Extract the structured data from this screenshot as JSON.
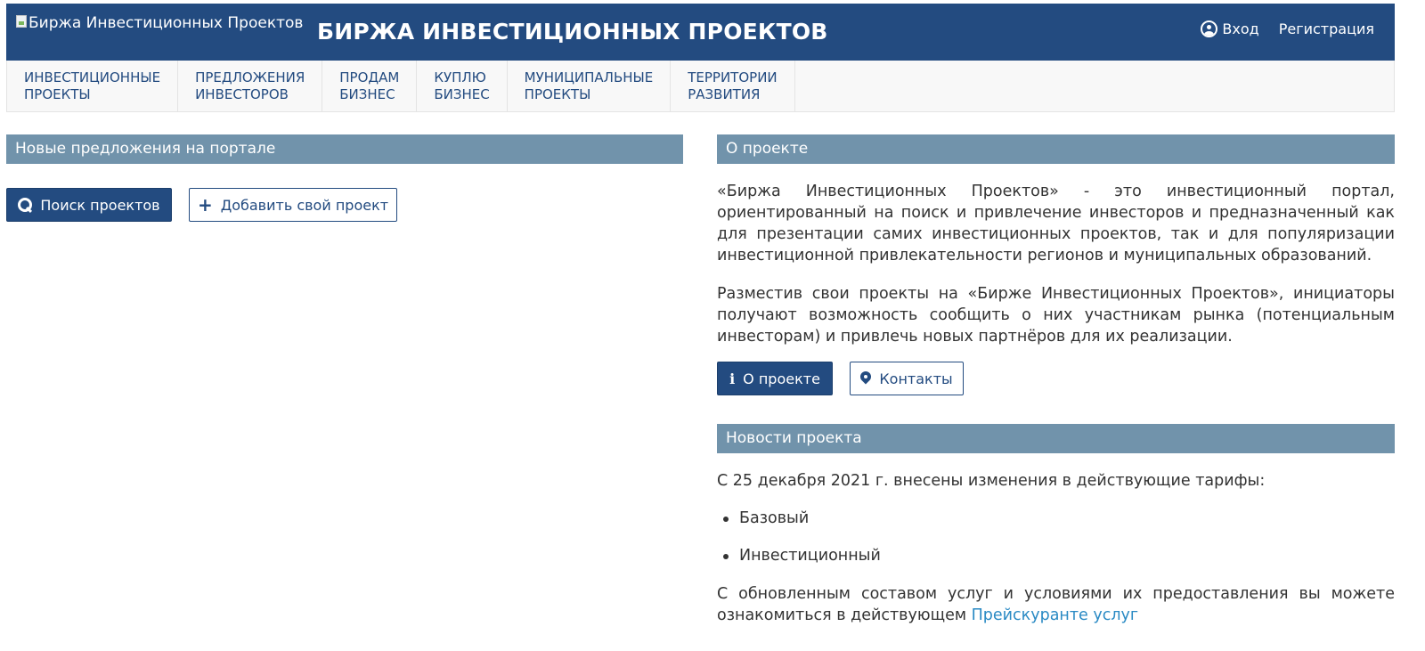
{
  "header": {
    "logo_alt": "Биржа Инвестиционных Проектов",
    "site_title": "БИРЖА ИНВЕСТИЦИОННЫХ ПРОЕКТОВ",
    "login_label": "Вход",
    "register_label": "Регистрация"
  },
  "nav": {
    "items": [
      {
        "line1": "ИНВЕСТИЦИОННЫЕ",
        "line2": "ПРОЕКТЫ"
      },
      {
        "line1": "ПРЕДЛОЖЕНИЯ",
        "line2": "ИНВЕСТОРОВ"
      },
      {
        "line1": "ПРОДАМ",
        "line2": "БИЗНЕС"
      },
      {
        "line1": "КУПЛЮ",
        "line2": "БИЗНЕС"
      },
      {
        "line1": "МУНИЦИПАЛЬНЫЕ",
        "line2": "ПРОЕКТЫ"
      },
      {
        "line1": "ТЕРРИТОРИИ",
        "line2": "РАЗВИТИЯ"
      }
    ]
  },
  "left": {
    "section_title": "Новые предложения на портале",
    "search_button": "Поиск проектов",
    "add_button": "Добавить свой проект"
  },
  "about": {
    "section_title": "О проекте",
    "paragraph1": "«Биржа Инвестиционных Проектов» - это инвестиционный портал, ориентированный на поиск и привлечение инвесторов и предназначенный как для презентации самих инвестиционных проектов, так и для популяризации инвестиционной привлекательности регионов и муниципальных образований.",
    "paragraph2": "Разместив свои проекты на «Бирже Инвестиционных Проектов», инициаторы получают возможность сообщить о них участникам рынка (потенциальным инвесторам) и привлечь новых партнёров для их реализации.",
    "about_button": "О проекте",
    "contacts_button": "Контакты"
  },
  "news": {
    "section_title": "Новости проекта",
    "intro": "С 25 декабря 2021 г. внесены изменения в действующие тарифы:",
    "items": [
      "Базовый",
      "Инвестиционный"
    ],
    "outro_text": "С обновленным составом услуг и условиями их предоставления вы можете ознакомиться в действующем",
    "outro_link": "Прейскуранте услуг"
  },
  "colors": {
    "brand": "#234b80",
    "section_header": "#7193ab",
    "link": "#2a8ac4"
  }
}
